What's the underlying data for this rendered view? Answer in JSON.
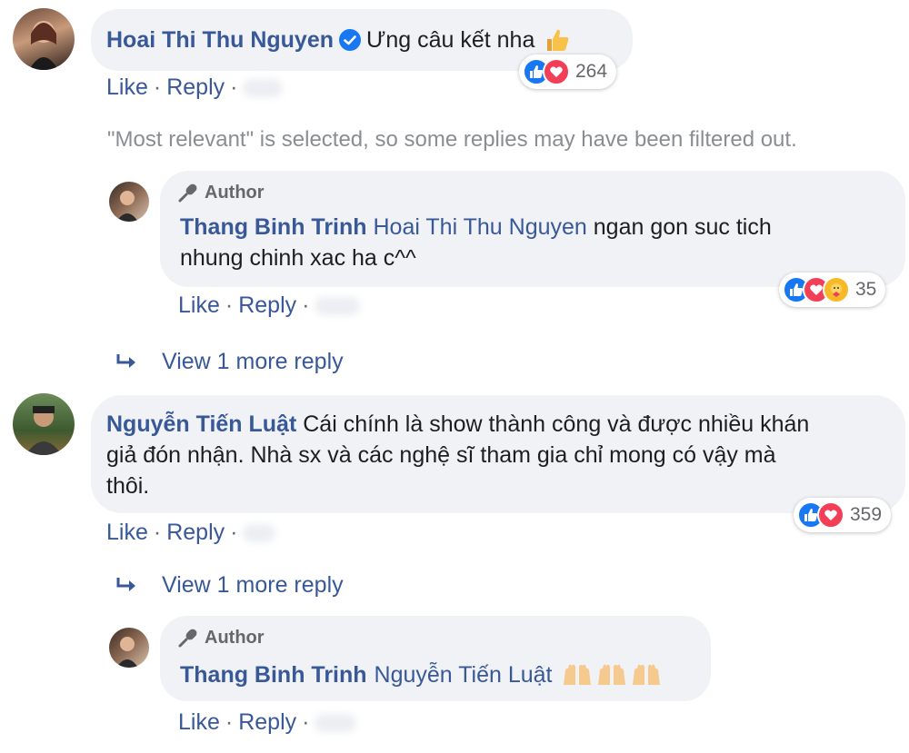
{
  "comments": [
    {
      "author": "Hoai Thi Thu Nguyen",
      "text": "Ưng câu kết nha",
      "emoji_icon": "thumbs-up-emoji",
      "reaction_count": "264",
      "actions": {
        "like": "Like",
        "reply": "Reply"
      }
    },
    {
      "author": "Nguyễn Tiến Luật",
      "text_line1": "Cái chính là show thành công và được nhiều khán",
      "text_line2": "giả đón nhận. Nhà sx và các nghệ sĩ tham gia chỉ mong có vậy mà",
      "text_line3": "thôi.",
      "reaction_count": "359",
      "actions": {
        "like": "Like",
        "reply": "Reply"
      }
    }
  ],
  "filter_note": "\"Most relevant\" is selected, so some replies may have been filtered out.",
  "replies": [
    {
      "badge": "Author",
      "author": "Thang Binh Trinh",
      "mention": "Hoai Thi Thu Nguyen",
      "text_line1": "ngan gon suc tich",
      "text_line2": "nhung chinh xac ha c^^",
      "reaction_count": "35",
      "actions": {
        "like": "Like",
        "reply": "Reply"
      }
    },
    {
      "badge": "Author",
      "author": "Thang Binh Trinh",
      "mention": "Nguyễn Tiến Luật",
      "emoji_icon": "raising-hands-emoji",
      "actions": {
        "like": "Like",
        "reply": "Reply"
      }
    }
  ],
  "view_more": [
    "View 1 more reply",
    "View 1 more reply"
  ],
  "colors": {
    "link": "#385898",
    "bubble": "#f0f2f5",
    "like": "#1877f2",
    "love": "#f33e58",
    "care": "#f7b928",
    "verified": "#1877f2"
  }
}
